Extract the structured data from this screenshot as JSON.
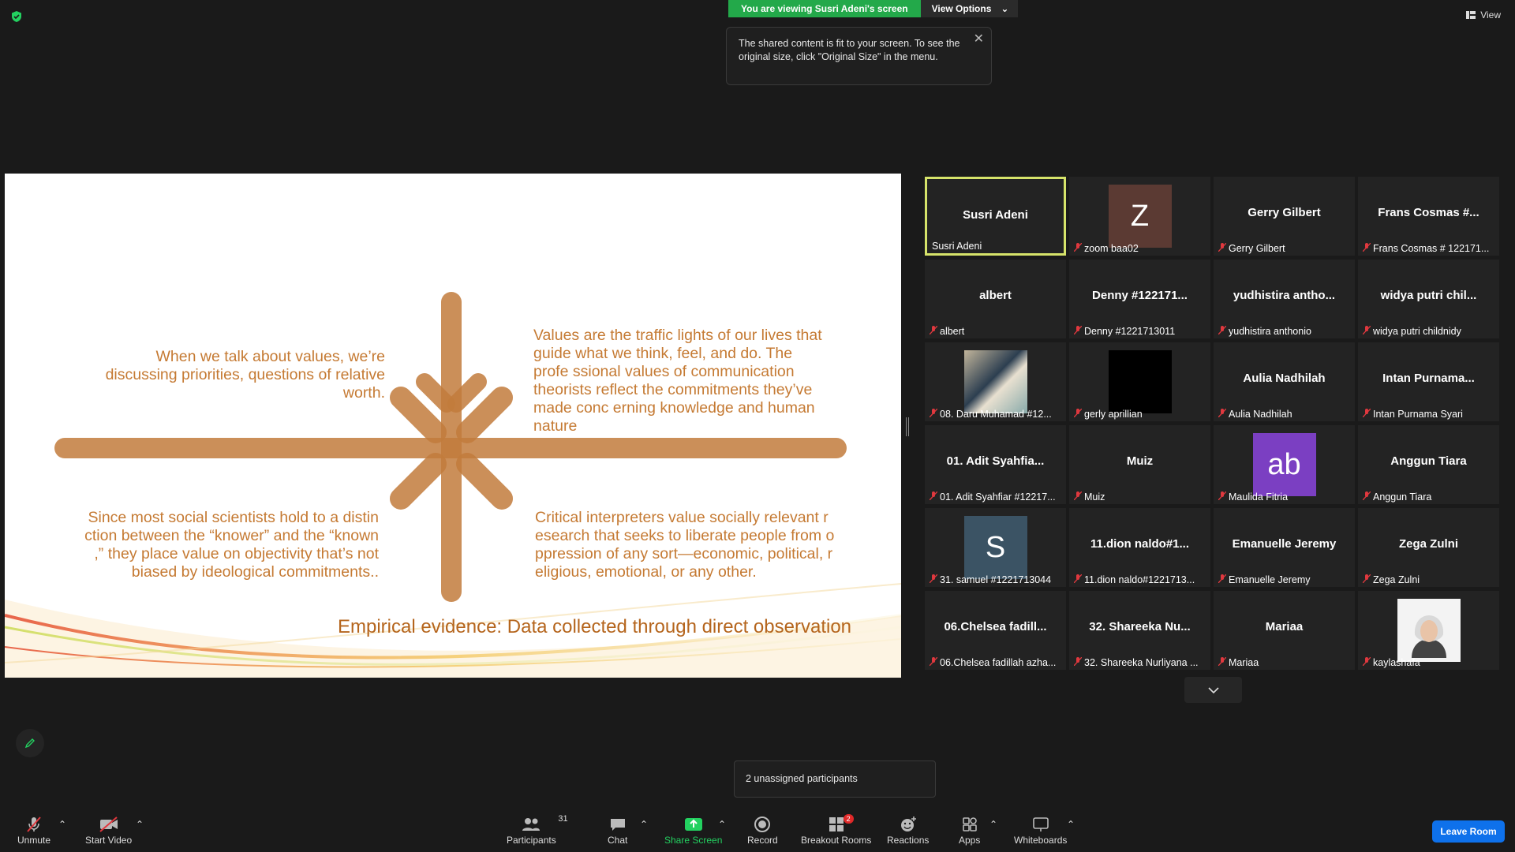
{
  "banner": {
    "viewing_text": "You are viewing Susri Adeni's screen",
    "view_options": "View Options",
    "view_label": "View"
  },
  "tooltip": {
    "text": "The shared content is fit to your screen. To see the original size, click \"Original Size\" in the menu."
  },
  "slide": {
    "top_left": "When we talk about values, we’re discussing priorities, questions of relative worth.",
    "top_right": "Values are the traffic lights of our lives that guide what we think, feel, and do. The profe ssional values of communication theorists reflect the commitments they’ve made conc erning knowledge and human nature",
    "bottom_left": "Since most social scientists hold to a distin ction between the “knower” and the “known ,” they place value on objectivity that’s not biased by ideological commitments..",
    "bottom_right": "Critical interpreters value socially relevant r esearch that seeks to liberate people from o ppression of any sort—economic, political, r eligious, emotional, or any other.",
    "footer": "Empirical evidence: Data collected through direct observation",
    "accent_color": "#c57a33"
  },
  "participants": [
    {
      "big": "Susri Adeni",
      "label": "Susri Adeni",
      "muted": false,
      "active": true
    },
    {
      "big": "",
      "label": "zoom baa02",
      "muted": true,
      "avatar": "Z",
      "avatar_color": "#5b3a33"
    },
    {
      "big": "Gerry Gilbert",
      "label": "Gerry Gilbert",
      "muted": true
    },
    {
      "big": "Frans Cosmas #...",
      "label": "Frans Cosmas # 122171...",
      "muted": true
    },
    {
      "big": "albert",
      "label": "albert",
      "muted": true
    },
    {
      "big": "Denny #122171...",
      "label": "Denny #1221713011",
      "muted": true
    },
    {
      "big": "yudhistira antho...",
      "label": "yudhistira anthonio",
      "muted": true
    },
    {
      "big": "widya putri chil...",
      "label": "widya putri childnidy",
      "muted": true
    },
    {
      "big": "",
      "label": "08. Daru Muhamad #12...",
      "muted": true,
      "avatar": "img-collage"
    },
    {
      "big": "",
      "label": "gerly aprillian",
      "muted": true,
      "avatar": "black"
    },
    {
      "big": "Aulia Nadhilah",
      "label": "Aulia Nadhilah",
      "muted": true
    },
    {
      "big": "Intan Purnama...",
      "label": "Intan Purnama Syari",
      "muted": true
    },
    {
      "big": "01. Adit Syahfia...",
      "label": "01. Adit Syahfiar #12217...",
      "muted": true
    },
    {
      "big": "Muiz",
      "label": "Muiz",
      "muted": true
    },
    {
      "big": "",
      "label": "Maulida Fitria",
      "muted": true,
      "avatar": "ab",
      "avatar_color": "#7b3fc2"
    },
    {
      "big": "Anggun Tiara",
      "label": "Anggun Tiara",
      "muted": true
    },
    {
      "big": "",
      "label": "31. samuel #1221713044",
      "muted": true,
      "avatar": "S",
      "avatar_color": "#3b5364"
    },
    {
      "big": "11.dion naldo#1...",
      "label": "11.dion naldo#1221713...",
      "muted": true
    },
    {
      "big": "Emanuelle Jeremy",
      "label": "Emanuelle Jeremy",
      "muted": true
    },
    {
      "big": "Zega Zulni",
      "label": "Zega Zulni",
      "muted": true
    },
    {
      "big": "06.Chelsea fadill...",
      "label": "06.Chelsea fadillah azha...",
      "muted": true
    },
    {
      "big": "32. Shareeka Nu...",
      "label": "32. Shareeka Nurliyana ...",
      "muted": true
    },
    {
      "big": "Mariaa",
      "label": "Mariaa",
      "muted": true
    },
    {
      "big": "",
      "label": "kaylashafa",
      "muted": true,
      "avatar": "photo"
    }
  ],
  "breakout_popup": "2 unassigned participants",
  "toolbar": {
    "unmute": "Unmute",
    "start_video": "Start Video",
    "participants": "Participants",
    "participants_count": "31",
    "chat": "Chat",
    "share_screen": "Share Screen",
    "record": "Record",
    "breakout_rooms": "Breakout Rooms",
    "breakout_badge": "2",
    "reactions": "Reactions",
    "apps": "Apps",
    "whiteboards": "Whiteboards",
    "leave": "Leave Room"
  }
}
